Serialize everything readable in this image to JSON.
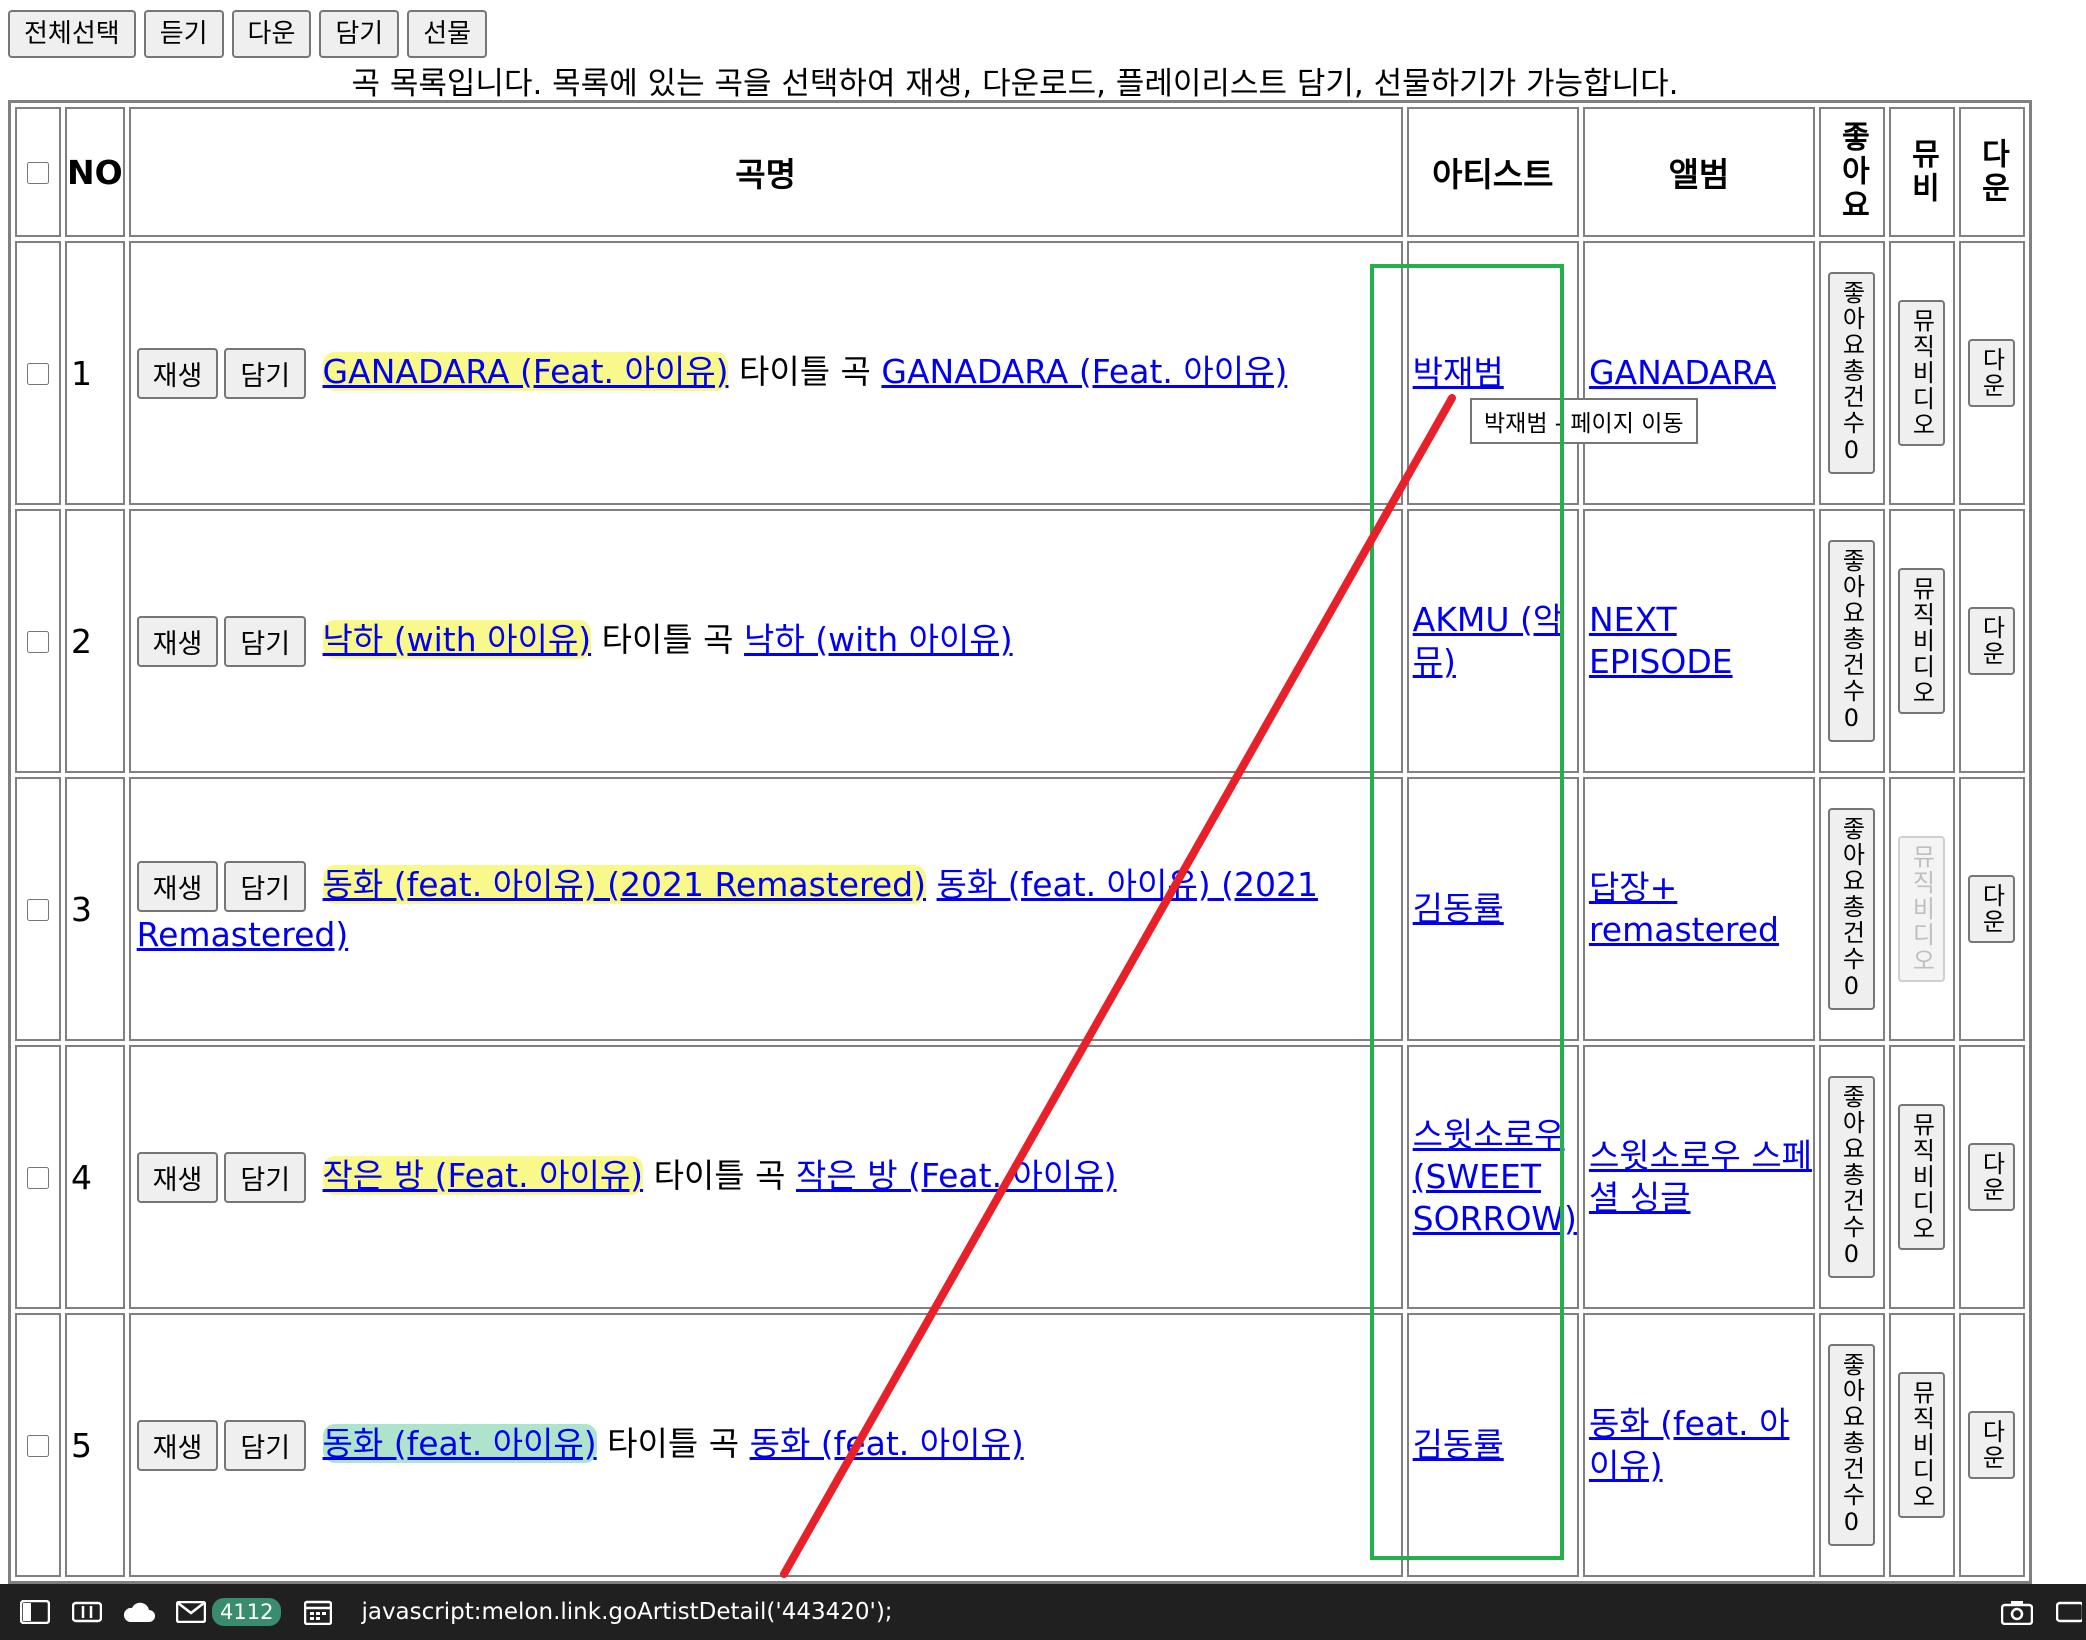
{
  "toolbar": {
    "select_all": "전체선택",
    "listen": "듣기",
    "download": "다운",
    "add": "담기",
    "gift": "선물"
  },
  "caption": "곡 목록입니다. 목록에 있는 곡을 선택하여 재생, 다운로드, 플레이리스트 담기, 선물하기가 가능합니다.",
  "table": {
    "headers": {
      "no": "NO",
      "title": "곡명",
      "artist": "아티스트",
      "album": "앨범",
      "like": "좋아요",
      "mv": "뮤비",
      "down": "다운"
    },
    "play_label": "재생",
    "add_label": "담기",
    "title_suffix": "타이틀 곡",
    "like_label": "좋아요총건수0",
    "mv_label": "뮤직비디오",
    "down_label": "다운",
    "rows": [
      {
        "no": "1",
        "title": "GANADARA (Feat. 아이유)",
        "artist": "박재범",
        "album": "GANADARA"
      },
      {
        "no": "2",
        "title": "낙하 (with 아이유)",
        "artist": "AKMU (악뮤)",
        "album": "NEXT EPISODE"
      },
      {
        "no": "3",
        "title": "동화 (feat. 아이유) (2021 Remastered)",
        "artist": "김동률",
        "album": "답장+ remastered"
      },
      {
        "no": "4",
        "title": "작은 방 (Feat. 아이유)",
        "artist": "스윗소로우 (SWEET SORROW)",
        "album": "스윗소로우 스페셜 싱글"
      },
      {
        "no": "5",
        "title": "동화 (feat. 아이유)",
        "artist": "김동률",
        "album": "동화 (feat. 아이유)"
      }
    ]
  },
  "tooltip": "박재범 - 페이지 이동",
  "statusbar": {
    "badge": "4112",
    "text": "javascript:melon.link.goArtistDetail('443420');"
  },
  "colors": {
    "annotation_red": "#e8202a",
    "annotation_green": "#22b04b",
    "highlight_yellow": "#f5f55a",
    "link_blue": "#0000ee"
  }
}
